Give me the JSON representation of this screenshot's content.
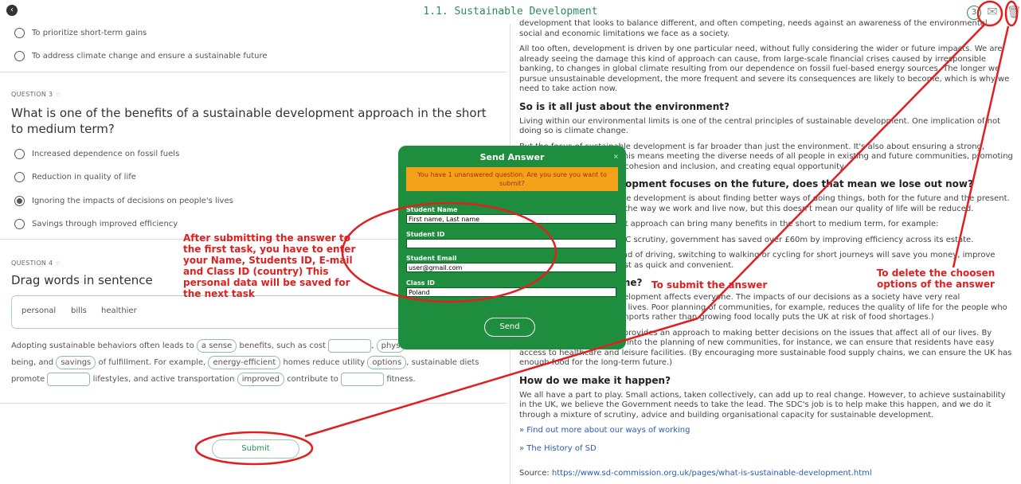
{
  "header": {
    "title": "1.1. Sustainable Development",
    "back_icon": "chevron-left-icon",
    "count": "3",
    "send_icon": "envelope-icon",
    "delete_icon": "trash-icon"
  },
  "quiz": {
    "q2_options": [
      {
        "label": "To prioritize short-term gains",
        "selected": false
      },
      {
        "label": "To address climate change and ensure a sustainable future",
        "selected": false
      }
    ],
    "q3": {
      "label": "QUESTION 3",
      "text": "What is one of the benefits of a sustainable development approach in the short to medium term?",
      "options": [
        {
          "label": "Increased dependence on fossil fuels",
          "selected": false
        },
        {
          "label": "Reduction in quality of life",
          "selected": false
        },
        {
          "label": "Ignoring the impacts of decisions on people's lives",
          "selected": true
        },
        {
          "label": "Savings through improved efficiency",
          "selected": false
        }
      ]
    },
    "q4": {
      "label": "QUESTION 4",
      "text": "Drag words in sentence",
      "words": [
        "personal",
        "bills",
        "healthier"
      ],
      "sentence": {
        "s1": "Adopting sustainable behaviors often leads to",
        "c1": "a sense",
        "s2": "benefits, such as cost",
        "c2": "phys",
        "s3": "being, and",
        "c3": "savings",
        "s4": "of fulfillment. For example,",
        "c4": "energy-efficient",
        "s5": "homes reduce utility",
        "c5": "options",
        "s6": ", sustainable diets",
        "s7": "promote",
        "s8": "lifestyles, and active transportation",
        "c6": "improved",
        "s9": "contribute to",
        "s10": "fitness."
      }
    },
    "submit_label": "Submit"
  },
  "modal": {
    "title": "Send Answer",
    "close": "×",
    "warning": "You have 1 unanswered question. Are you sure you want to submit?",
    "fields": [
      {
        "label": "Student Name",
        "value": "First name, Last name"
      },
      {
        "label": "Student ID",
        "value": ""
      },
      {
        "label": "Student Email",
        "value": "user@gmail.com"
      },
      {
        "label": "Class ID",
        "value": "Poland"
      }
    ],
    "send_label": "Send"
  },
  "article": {
    "p1": "development that looks to balance different, and often competing, needs against an awareness of the environmental, social and economic limitations we face as a society.",
    "p2": "All too often, development is driven by one particular need, without fully considering the wider or future impacts. We are already seeing the damage this kind of approach can cause, from large-scale financial crises caused by irresponsible banking, to changes in global climate resulting from our dependence on fossil fuel-based energy sources. The longer we pursue unsustainable development, the more frequent and severe its consequences are likely to become, which is why we need to take action now.",
    "h1": "So is it all just about the environment?",
    "p3": "Living within our environmental limits is one of the central principles of sustainable development. One implication of not doing so is climate change.",
    "p4": "But the focus of sustainable development is far broader than just the environment. It's also about ensuring a strong, healthy and just society. This means meeting the diverse needs of all people in existing and future communities, promoting personal wellbeing, social cohesion and inclusion, and creating equal opportunity.",
    "h2": "If sustainable development focuses on the future, does that mean we lose out now?",
    "p5": "Not necessarily. Sustainable development is about finding better ways of doing things, both for the future and the present. We might need to change the way we work and live now, but this doesn't mean our quality of life will be reduced.",
    "p6": "A sustainable development approach can bring many benefits in the short to medium term, for example:",
    "p7": "Savings – As a result of SDC scrutiny, government has saved over £60m by improving efficiency across its estate.",
    "p8": "Health & Transport – Instead of driving, switching to walking or cycling for short journeys will save you money, improve your health and is often just as quick and convenient.",
    "h3": "How does it affect me?",
    "p9": "The way we approach development affects everyone. The impacts of our decisions as a society have very real consequences for people's lives. Poor planning of communities, for example, reduces the quality of life for the people who live in them. (Relying on imports rather than growing food locally puts the UK at risk of food shortages.)",
    "p10": "Sustainable development provides an approach to making better decisions on the issues that affect all of our lives. By incorporating health plans into the planning of new communities, for instance, we can ensure that residents have easy access to healthcare and leisure facilities. (By encouraging more sustainable food supply chains, we can ensure the UK has enough food for the long-term future.)",
    "h4": "How do we make it happen?",
    "p11": "We all have a part to play. Small actions, taken collectively, can add up to real change. However, to achieve sustainability in the UK, we believe the Government needs to take the lead. The SDC's job is to help make this happen, and we do it through a mixture of scrutiny, advice and building organisational capacity for sustainable development.",
    "link1": "» Find out more about our ways of working",
    "link2": "» The History of SD",
    "source_prefix": "Source: ",
    "source_url": "https://www.sd-commission.org.uk/pages/what-is-sustainable-development.html"
  },
  "annotations": {
    "note_left": "After submitting the answer to the first task, you have to enter your Name, Students ID, E-mail and Class ID (country) This personal data will be saved for the next task",
    "note_submit": "To submit the answer",
    "note_delete": "To delete the choosen options of the answer",
    "color": "#e02020"
  }
}
